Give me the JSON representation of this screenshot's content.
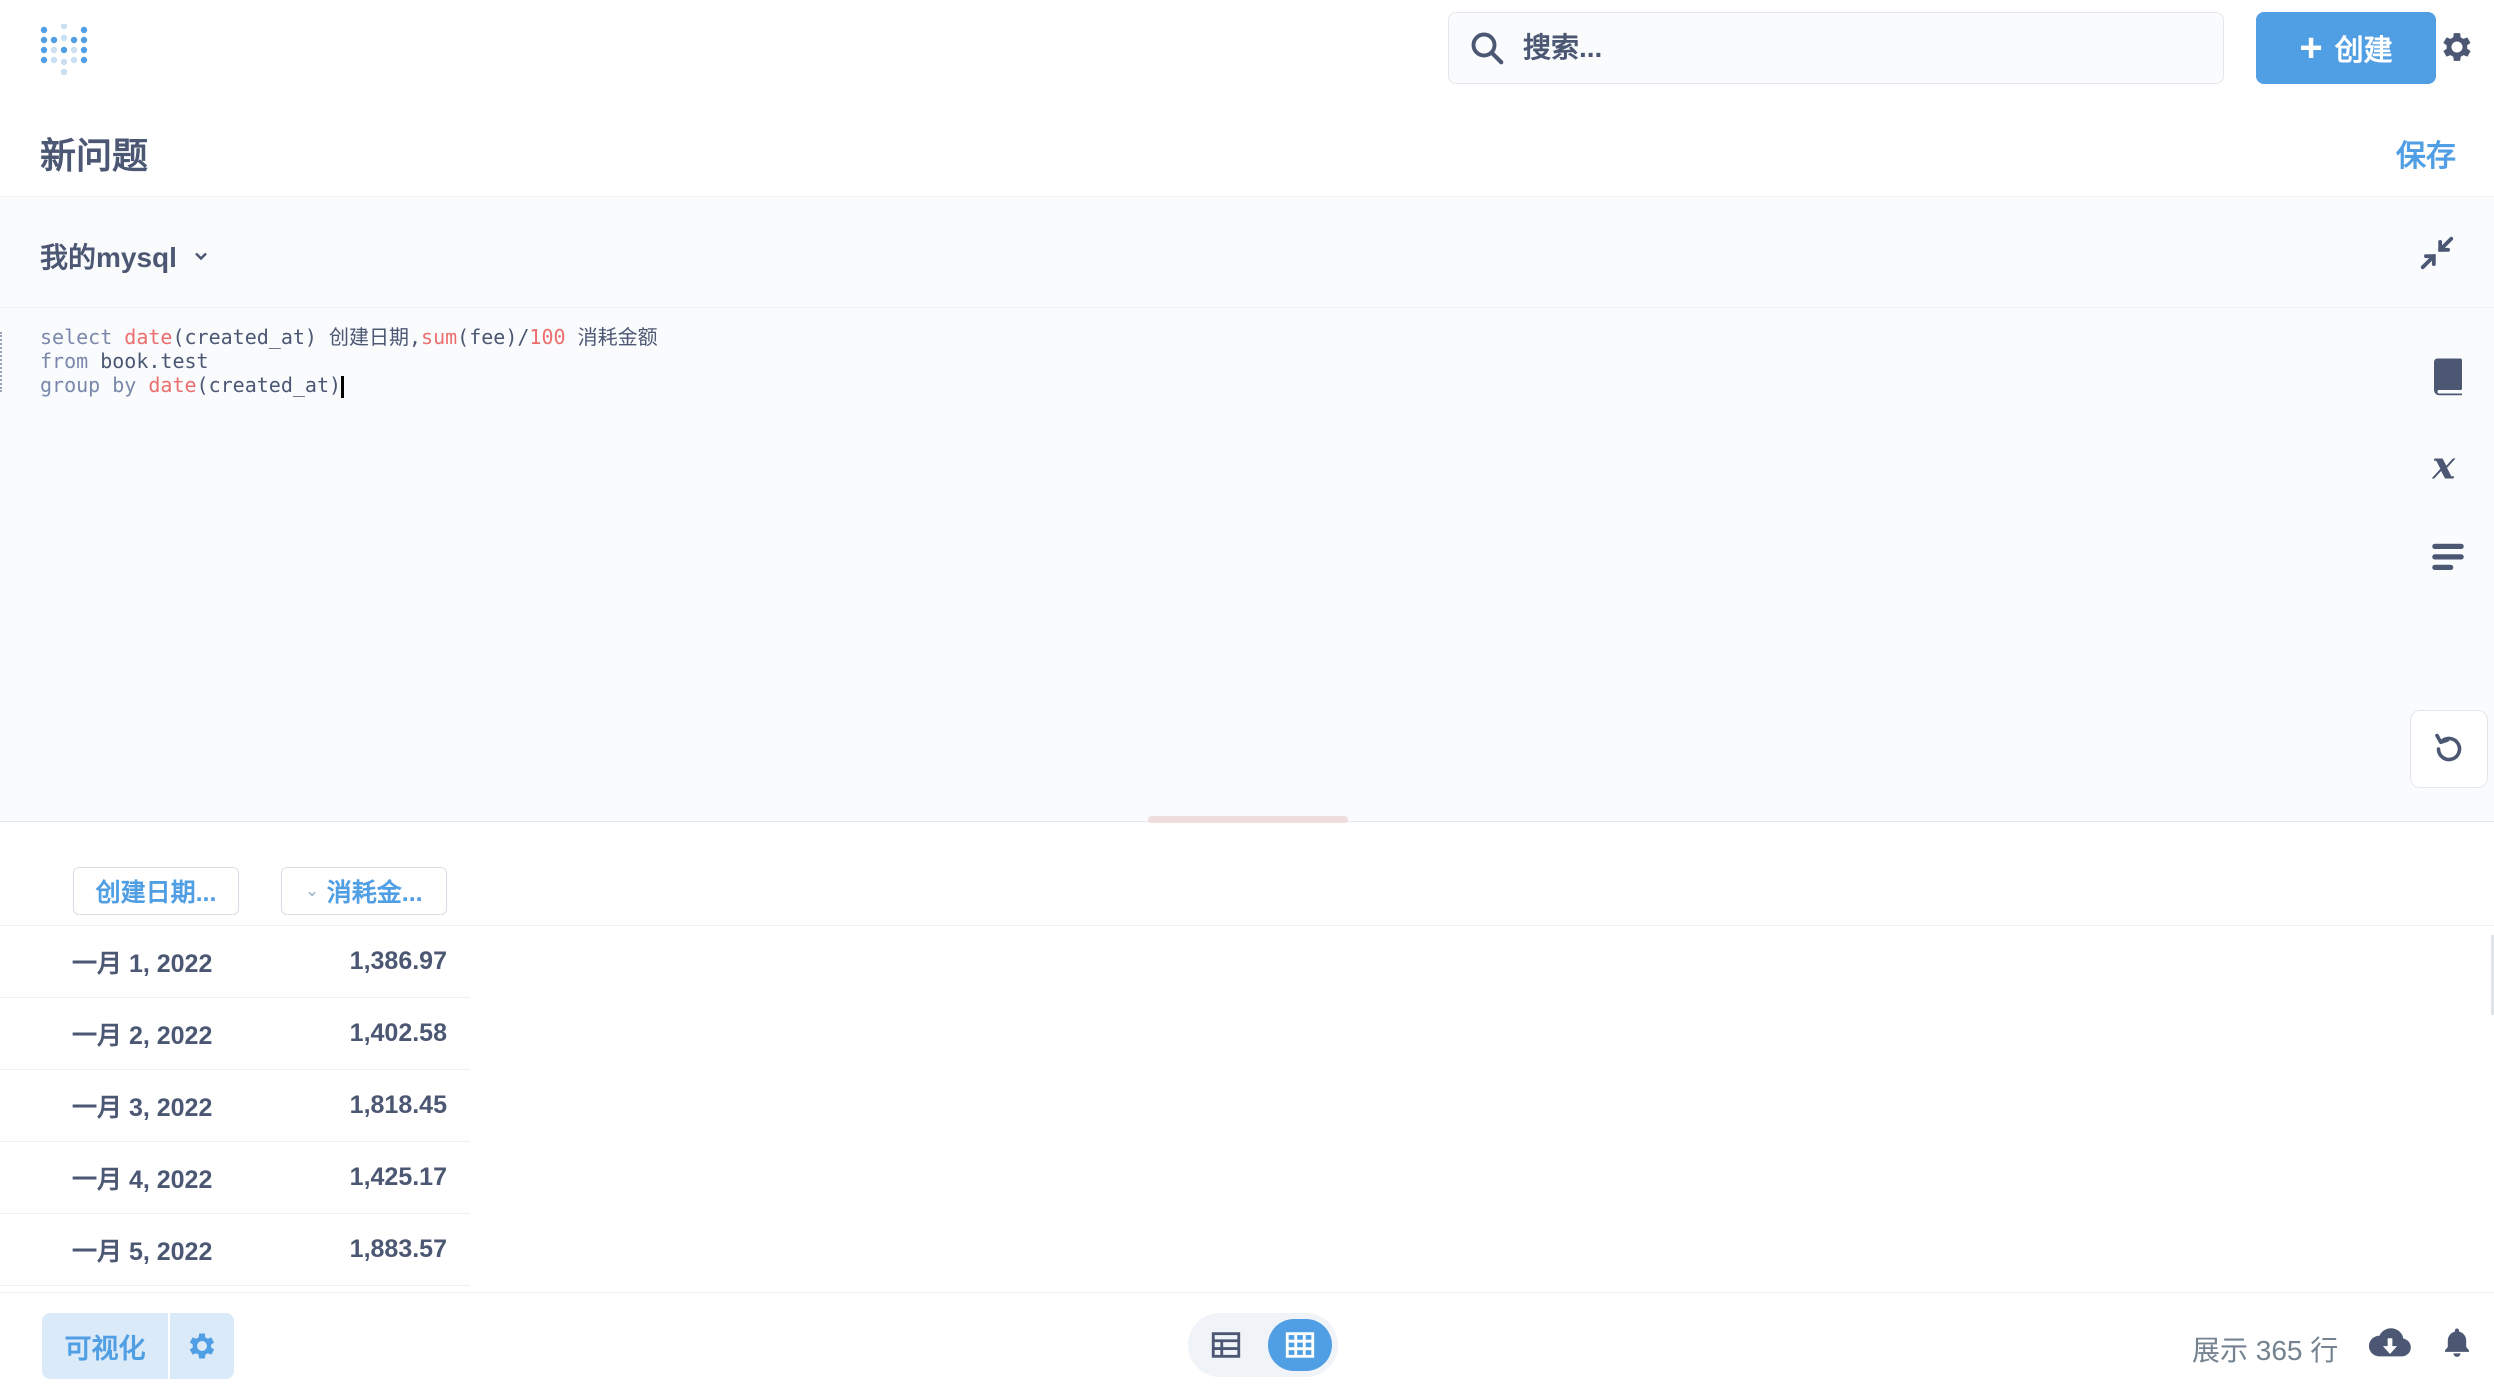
{
  "header": {
    "search_placeholder": "搜索...",
    "create_label": "创建"
  },
  "question": {
    "title": "新问题",
    "save_label": "保存"
  },
  "editor": {
    "database": "我的mysql",
    "query_lines": [
      "select date(created_at) 创建日期,sum(fee)/100 消耗金额",
      "from book.test",
      "group by date(created_at)"
    ]
  },
  "results": {
    "columns": [
      "创建日期...",
      "消耗金..."
    ],
    "rows": [
      [
        "一月 1, 2022",
        "1,386.97"
      ],
      [
        "一月 2, 2022",
        "1,402.58"
      ],
      [
        "一月 3, 2022",
        "1,818.45"
      ],
      [
        "一月 4, 2022",
        "1,425.17"
      ],
      [
        "一月 5, 2022",
        "1,883.57"
      ]
    ]
  },
  "footer": {
    "visualize_label": "可视化",
    "row_count": "展示 365 行"
  },
  "colors": {
    "brand": "#509ee3",
    "text": "#4c5773",
    "keyword": "#7a88ab",
    "function": "#ed6e6e"
  }
}
